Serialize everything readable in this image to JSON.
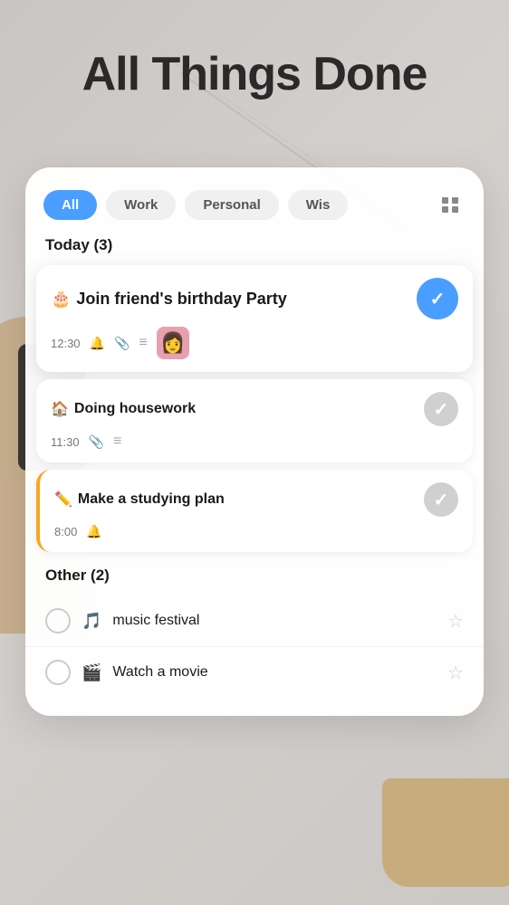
{
  "app": {
    "title": "All Things Done"
  },
  "tabs": [
    {
      "id": "all",
      "label": "All",
      "active": true
    },
    {
      "id": "work",
      "label": "Work",
      "active": false
    },
    {
      "id": "personal",
      "label": "Personal",
      "active": false
    },
    {
      "id": "wis",
      "label": "Wis",
      "active": false
    }
  ],
  "today_section": {
    "header": "Today (3)",
    "tasks": [
      {
        "id": 1,
        "emoji": "🎂",
        "title": "Join friend's birthday Party",
        "time": "12:30",
        "has_bell": true,
        "has_attachment": true,
        "has_list": true,
        "has_thumbnail": true,
        "completed": true,
        "highlighted": true
      },
      {
        "id": 2,
        "emoji": "🏠",
        "title": "Doing housework",
        "time": "11:30",
        "has_bell": false,
        "has_attachment": true,
        "has_list": true,
        "has_thumbnail": false,
        "completed": false,
        "highlighted": false
      },
      {
        "id": 3,
        "emoji": "✏️",
        "title": "Make a studying plan",
        "time": "8:00",
        "has_bell": true,
        "has_attachment": false,
        "has_list": false,
        "has_thumbnail": false,
        "completed": false,
        "highlighted": false,
        "yellow_border": true
      }
    ]
  },
  "other_section": {
    "header": "Other (2)",
    "tasks": [
      {
        "id": 4,
        "emoji": "🎵",
        "title": "music festival",
        "starred": false
      },
      {
        "id": 5,
        "emoji": "🎬",
        "title": "Watch a movie",
        "starred": false
      }
    ]
  },
  "icons": {
    "bell": "🔔",
    "attachment": "📎",
    "list": "≡",
    "grid": "⊞",
    "check": "✓",
    "star_empty": "☆",
    "star_filled": "★"
  }
}
